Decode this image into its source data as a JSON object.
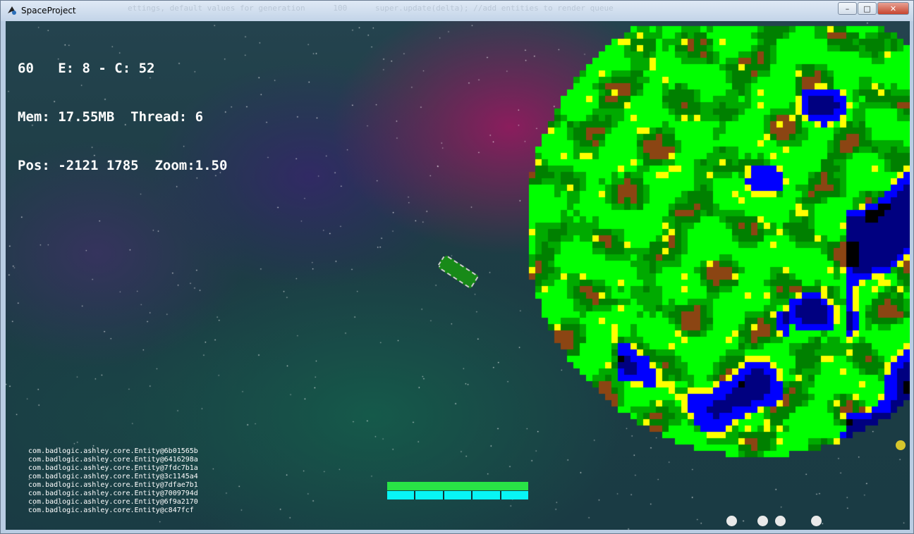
{
  "window": {
    "title": "SpaceProject",
    "background_code": "ettings, default values for generation      100      super.update(delta); //add entities to render queue",
    "buttons": {
      "minimize": "–",
      "maximize": "□",
      "close": "✕"
    }
  },
  "hud": {
    "line1": "60   E: 8 - C: 52",
    "line2": "Mem: 17.55MB  Thread: 6",
    "line3": "Pos: -2121 1785  Zoom:1.50"
  },
  "entities": [
    "com.badlogic.ashley.core.Entity@6b01565b",
    "com.badlogic.ashley.core.Entity@6416298a",
    "com.badlogic.ashley.core.Entity@7fdc7b1a",
    "com.badlogic.ashley.core.Entity@3c1145a4",
    "com.badlogic.ashley.core.Entity@7dfae7b1",
    "com.badlogic.ashley.core.Entity@7009794d",
    "com.badlogic.ashley.core.Entity@6f9a2170",
    "com.badlogic.ashley.core.Entity@c847fcf"
  ],
  "player": {
    "health_fraction": 1.0,
    "energy_segments": 5,
    "energy_full": 5
  },
  "colors": {
    "grass": "#00ff00",
    "forest": "#00aa00",
    "deep_forest": "#008000",
    "sand": "#ffff00",
    "water": "#0000ff",
    "deep_water": "#000080",
    "abyss": "#000000",
    "dirt": "#8b4513",
    "health": "#29e346",
    "energy": "#08f5f5"
  },
  "icons": {
    "app": "spaceship-app-icon",
    "sun": "sun-icon",
    "marker": "planet-marker-icon"
  }
}
